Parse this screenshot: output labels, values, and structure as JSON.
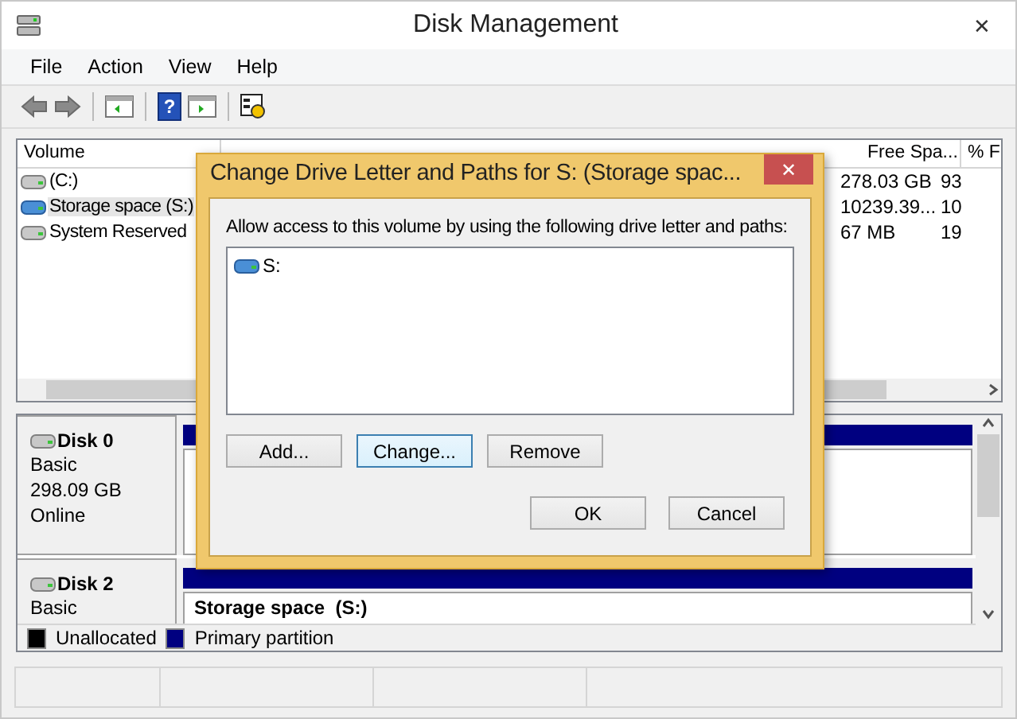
{
  "window": {
    "title": "Disk Management",
    "close_glyph": "✕"
  },
  "menu": [
    "File",
    "Action",
    "View",
    "Help"
  ],
  "toolbar": {
    "help_glyph": "?"
  },
  "volume_table": {
    "columns": [
      "Volume",
      "Free Spa...",
      "% F"
    ],
    "rows": [
      {
        "volume": "(C:)",
        "kind": "basic",
        "free_space": "278.03 GB",
        "percent_free": "93",
        "selected": false
      },
      {
        "volume": "Storage space (S:)",
        "kind": "storage",
        "free_space": "10239.39...",
        "percent_free": "10",
        "selected": true
      },
      {
        "volume": "System Reserved",
        "kind": "basic",
        "free_space": "67 MB",
        "percent_free": "19",
        "selected": false
      }
    ]
  },
  "disks": [
    {
      "name": "Disk 0",
      "details": [
        "Basic",
        "298.09 GB",
        "Online"
      ]
    },
    {
      "name": "Disk 2",
      "details": [
        "Basic"
      ],
      "partition_label": "Storage space  (S:)"
    }
  ],
  "legend": [
    {
      "label": "Unallocated",
      "color": "#000000"
    },
    {
      "label": "Primary partition",
      "color": "#000080"
    }
  ],
  "dialog": {
    "title": "Change Drive Letter and Paths for S: (Storage spac...",
    "close_glyph": "✕",
    "prompt": "Allow access to this volume by using the following drive letter and paths:",
    "paths": [
      "S:"
    ],
    "buttons": [
      {
        "label": "Add...",
        "focused": false
      },
      {
        "label": "Change...",
        "focused": true
      },
      {
        "label": "Remove",
        "focused": false
      }
    ],
    "footer_buttons": [
      "OK",
      "Cancel"
    ]
  }
}
